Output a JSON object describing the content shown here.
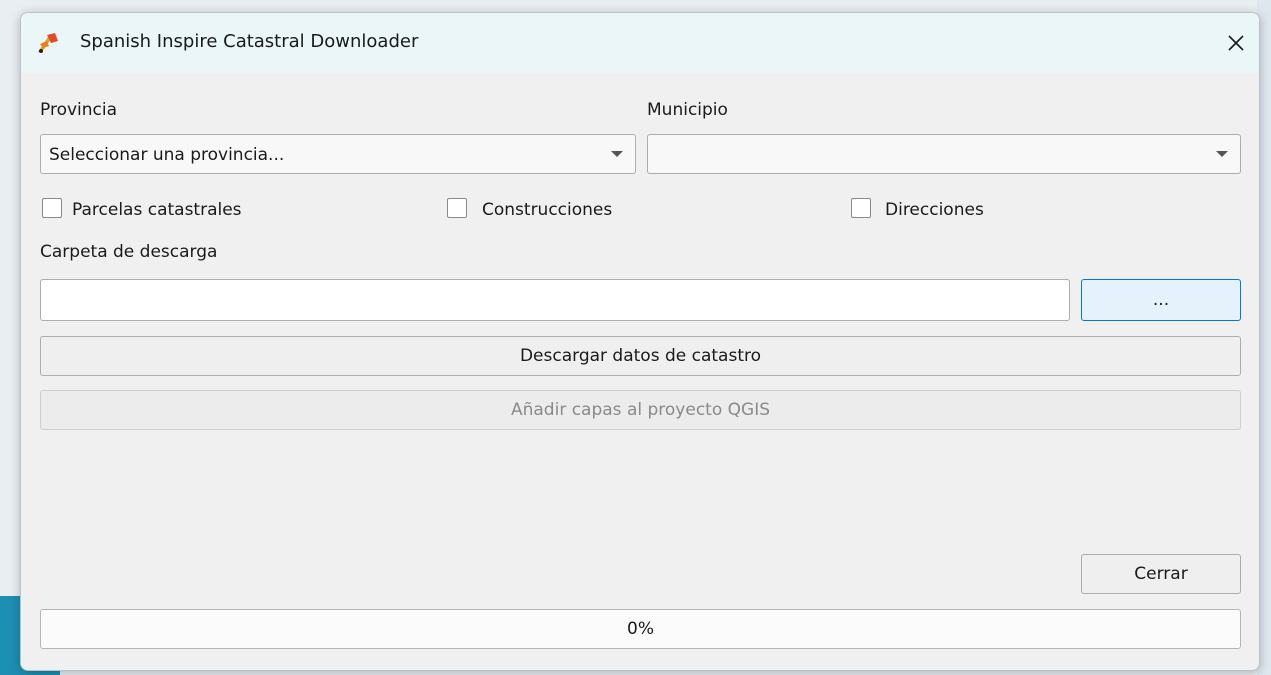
{
  "window": {
    "title": "Spanish Inspire Catastral Downloader",
    "app_icon": "qgis-plugin-icon",
    "close_icon": "close-icon"
  },
  "provincia": {
    "label": "Provincia",
    "value": "Seleccionar una provincia..."
  },
  "municipio": {
    "label": "Municipio",
    "value": ""
  },
  "checkboxes": [
    {
      "label": "Parcelas catastrales",
      "checked": false
    },
    {
      "label": "Construcciones",
      "checked": false
    },
    {
      "label": "Direcciones",
      "checked": false
    }
  ],
  "carpeta": {
    "label": "Carpeta de descarga",
    "value": "",
    "browse_label": "..."
  },
  "buttons": {
    "descargar": "Descargar datos de catastro",
    "anadir": "Añadir capas al proyecto QGIS",
    "cerrar": "Cerrar"
  },
  "progress": {
    "value": 0,
    "text": "0%"
  },
  "colors": {
    "titlebar": "#eaf6f8",
    "accent": "#0078d7"
  }
}
